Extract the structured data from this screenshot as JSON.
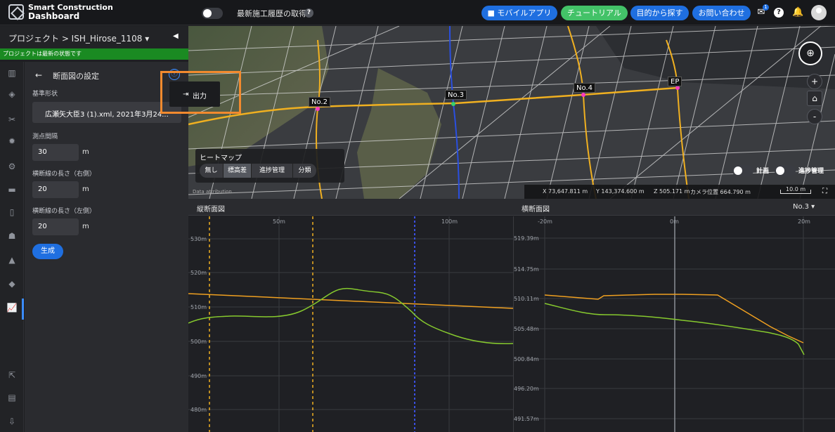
{
  "app": {
    "brand_line1": "Smart Construction",
    "brand_line2": "Dashboard"
  },
  "topbar": {
    "history_label": "最新施工履歴の取得",
    "help_glyph": "?",
    "buttons": [
      "■ モバイルアプリ",
      "チュートリアル",
      "目的から探す",
      "お問い合わせ"
    ],
    "mail_badge": "1",
    "icons": {
      "mail": "mail-icon",
      "help": "help-icon",
      "bell": "bell-icon"
    }
  },
  "project": {
    "title": "プロジェクト > ISH_Hirose_1108 ▾",
    "status": "プロジェクトは最新の状態です",
    "collapse": "◀"
  },
  "rail": {
    "icons": [
      "chart-icon",
      "layers-icon",
      "tools-icon",
      "settings-icon",
      "machine-icon",
      "folder-icon",
      "device-icon",
      "people-icon",
      "shapes-icon",
      "paint-icon",
      "section-chart-icon",
      "external-link-icon",
      "document-icon",
      "download-icon"
    ],
    "glyphs": [
      "▥",
      "◈",
      "✂",
      "✹",
      "⚙",
      "▬",
      "▯",
      "☗",
      "▲",
      "◆",
      "📈",
      "⇱",
      "▤",
      "⇩"
    ]
  },
  "panel": {
    "back": "←",
    "title": "断面図の設定",
    "info": "ⓘ",
    "base_shape_label": "基準形状",
    "base_shape_value": "広瀬矢大臣3 (1).xml, 2021年3月24...",
    "interval_label": "測点間隔",
    "interval_value": "30",
    "right_label": "横断線の長さ（右側）",
    "right_value": "20",
    "left_label": "横断線の長さ（左側）",
    "left_value": "20",
    "unit": "m",
    "generate": "生成"
  },
  "popup": {
    "icon": "⇥",
    "label": "出力"
  },
  "map": {
    "markers": [
      "No.2",
      "No.3",
      "No.4",
      "EP"
    ],
    "heatmap_title": "ヒートマップ",
    "heatmap_options": [
      "無し",
      "標高差",
      "進捗管理",
      "分類"
    ],
    "heatmap_selected": "標高差",
    "layer_plan": "計画",
    "layer_progress": "進捗管理",
    "coords": [
      "X 73,647.811 m",
      "Y 143,374.600 m",
      "Z 505.171 m",
      "カメラ位置 664.790 m"
    ],
    "scale": "10.0 m",
    "attribution": "Data attribution",
    "compass": "⊕",
    "zoom_in": "+",
    "home": "⌂",
    "zoom_out": "-",
    "fullscreen": "⛶"
  },
  "long_section": {
    "title": "縦断面図",
    "x_ticks": [
      "50m",
      "100m"
    ],
    "y_ticks": [
      "530m",
      "520m",
      "510m",
      "500m",
      "490m",
      "480m"
    ]
  },
  "cross_section": {
    "title": "横断面図",
    "station": "No.3 ▾",
    "x_ticks": [
      "-20m",
      "0m",
      "20m"
    ],
    "y_ticks": [
      "519.39m",
      "514.75m",
      "510.11m",
      "505.48m",
      "500.84m",
      "496.20m",
      "491.57m"
    ]
  },
  "colors": {
    "accent": "#1f6fe0",
    "tutorial": "#43c268",
    "status": "#1a8a22",
    "highlight": "#f28a2e",
    "design_line": "#f0a020",
    "ground_line": "#86c92e"
  }
}
